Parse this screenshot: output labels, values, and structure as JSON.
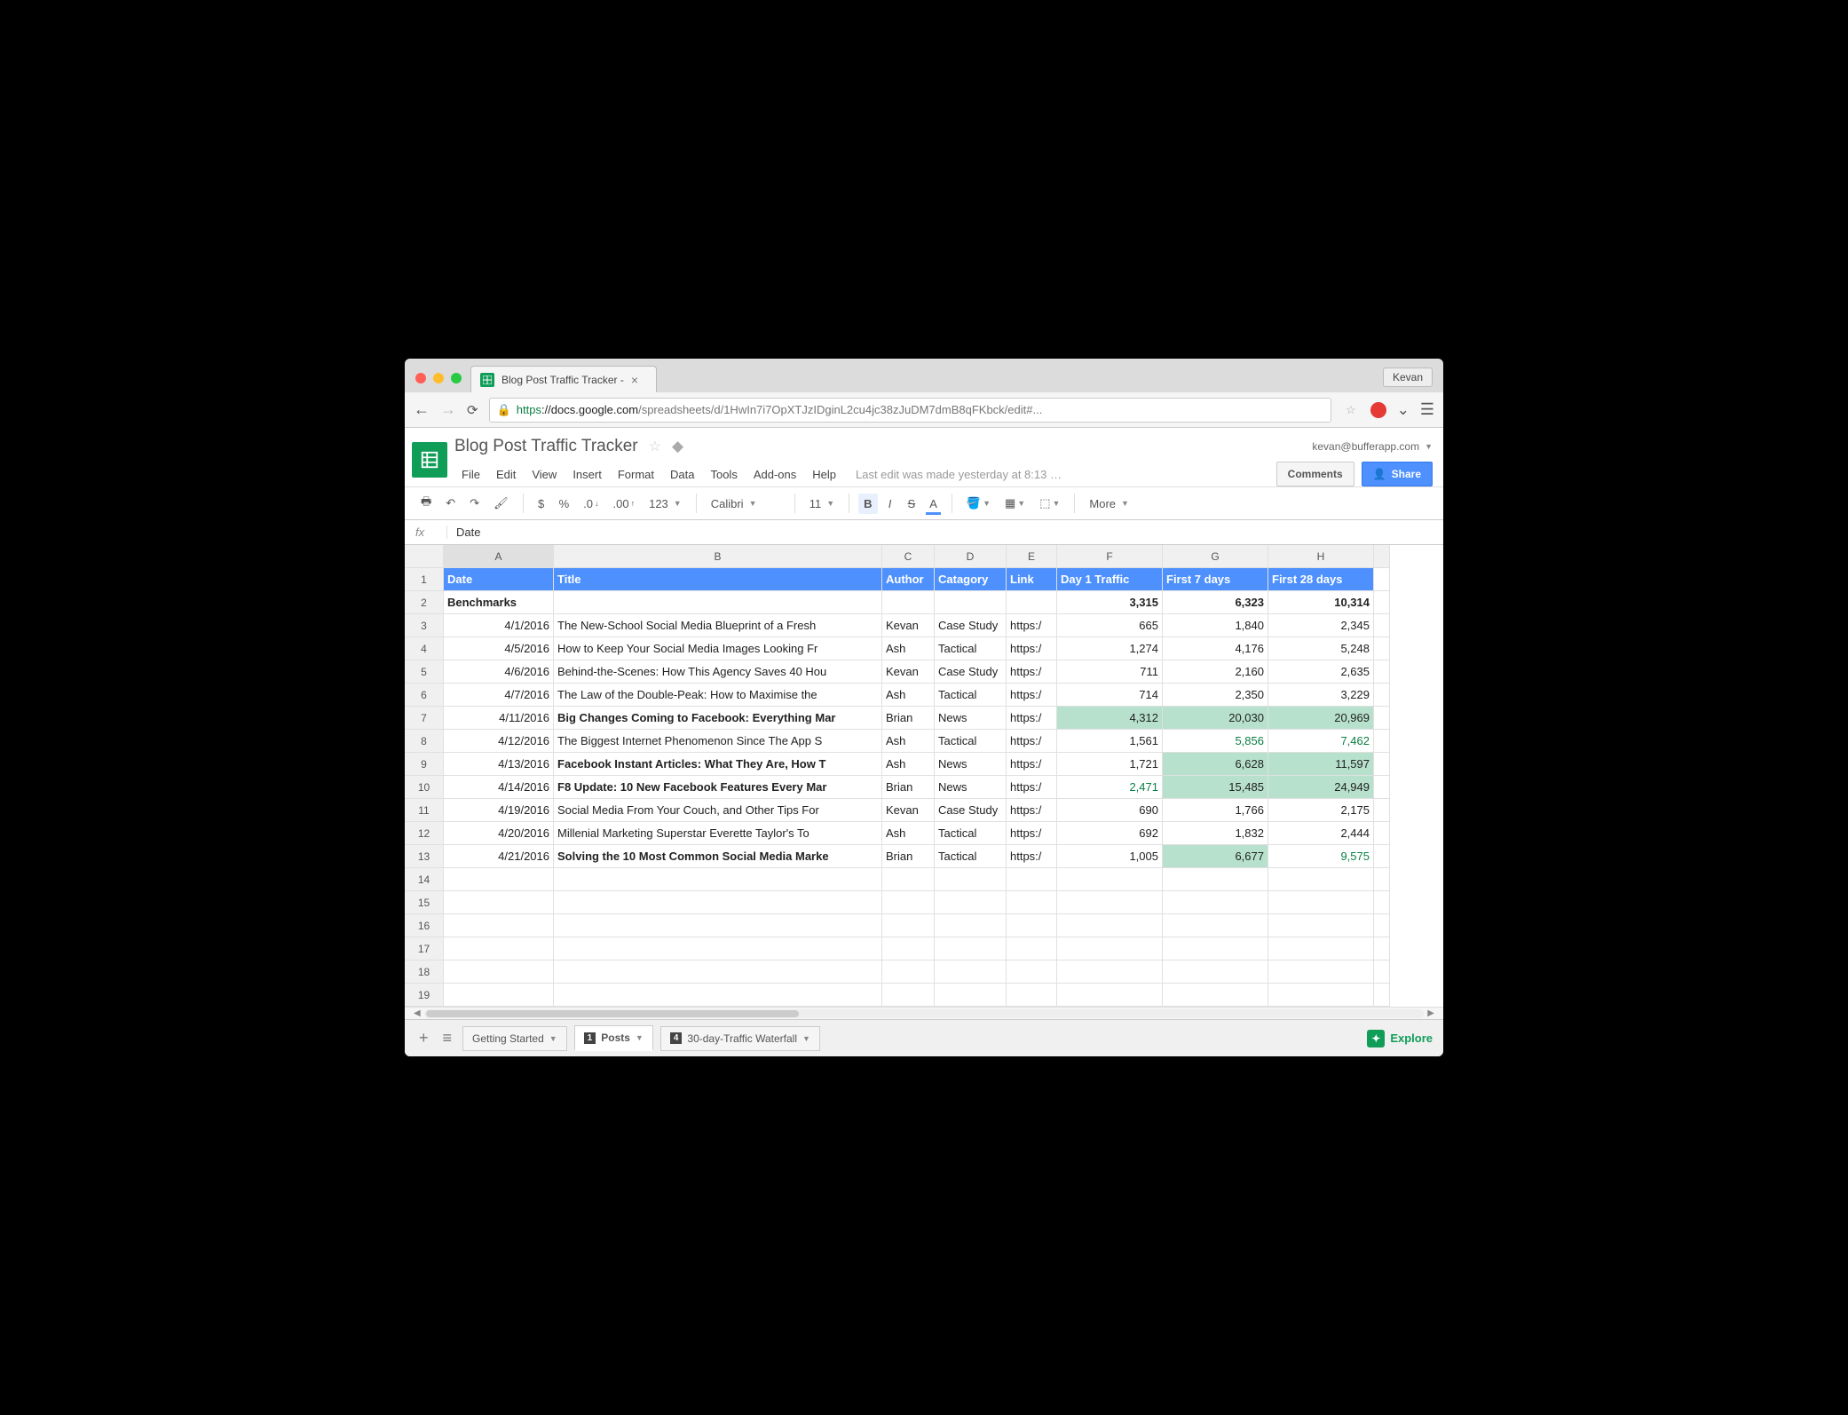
{
  "browser": {
    "tab_title": "Blog Post Traffic Tracker - ",
    "profile": "Kevan",
    "url_proto": "https",
    "url_host": "://docs.google.com",
    "url_path": "/spreadsheets/d/1HwIn7i7OpXTJzIDginL2cu4jc38zJuDM7dmB8qFKbck/edit#..."
  },
  "doc": {
    "title": "Blog Post Traffic Tracker",
    "account": "kevan@bufferapp.com",
    "menus": [
      "File",
      "Edit",
      "View",
      "Insert",
      "Format",
      "Data",
      "Tools",
      "Add-ons",
      "Help"
    ],
    "last_edit": "Last edit was made yesterday at 8:13 …",
    "comments": "Comments",
    "share": "Share"
  },
  "toolbar": {
    "currency": "$",
    "percent": "%",
    "dec_dec": ".0",
    "dec_inc": ".00",
    "num_fmt": "123",
    "font": "Calibri",
    "size": "11",
    "more": "More"
  },
  "formula": {
    "label": "fx",
    "value": "Date"
  },
  "columns": [
    "A",
    "B",
    "C",
    "D",
    "E",
    "F",
    "G",
    "H"
  ],
  "headers": {
    "A": "Date",
    "B": "Title",
    "C": "Author",
    "D": "Catagory",
    "E": "Link",
    "F": "Day 1 Traffic",
    "G": "First 7 days",
    "H": "First 28 days"
  },
  "benchmarks": {
    "label": "Benchmarks",
    "F": "3,315",
    "G": "6,323",
    "H": "10,314"
  },
  "rows": [
    {
      "n": 3,
      "date": "4/1/2016",
      "title": "The New-School Social Media Blueprint of a Fresh",
      "author": "Kevan",
      "cat": "Case Study",
      "link": "https:/",
      "f": "665",
      "g": "1,840",
      "h": "2,345"
    },
    {
      "n": 4,
      "date": "4/5/2016",
      "title": "How to Keep Your Social Media Images Looking Fr",
      "author": "Ash",
      "cat": "Tactical",
      "link": "https:/",
      "f": "1,274",
      "g": "4,176",
      "h": "5,248"
    },
    {
      "n": 5,
      "date": "4/6/2016",
      "title": "Behind-the-Scenes: How This Agency Saves 40 Hou",
      "author": "Kevan",
      "cat": "Case Study",
      "link": "https:/",
      "f": "711",
      "g": "2,160",
      "h": "2,635"
    },
    {
      "n": 6,
      "date": "4/7/2016",
      "title": "The Law of the Double-Peak: How to Maximise the",
      "author": "Ash",
      "cat": "Tactical",
      "link": "https:/",
      "f": "714",
      "g": "2,350",
      "h": "3,229"
    },
    {
      "n": 7,
      "date": "4/11/2016",
      "title": "Big Changes Coming to Facebook: Everything Mar",
      "author": "Brian",
      "cat": "News",
      "link": "https:/",
      "f": "4,312",
      "g": "20,030",
      "h": "20,969",
      "bold": true,
      "f_bg": true,
      "g_bg": true,
      "h_bg": true
    },
    {
      "n": 8,
      "date": "4/12/2016",
      "title": "The Biggest Internet Phenomenon Since The App S",
      "author": "Ash",
      "cat": "Tactical",
      "link": "https:/",
      "f": "1,561",
      "g": "5,856",
      "h": "7,462",
      "g_gt": true,
      "h_gt": true
    },
    {
      "n": 9,
      "date": "4/13/2016",
      "title": "Facebook Instant Articles: What They Are, How T",
      "author": "Ash",
      "cat": "News",
      "link": "https:/",
      "f": "1,721",
      "g": "6,628",
      "h": "11,597",
      "bold": true,
      "g_bg": true,
      "h_bg": true
    },
    {
      "n": 10,
      "date": "4/14/2016",
      "title": "F8 Update: 10 New Facebook Features Every Mar",
      "author": "Brian",
      "cat": "News",
      "link": "https:/",
      "f": "2,471",
      "g": "15,485",
      "h": "24,949",
      "bold": true,
      "f_gt": true,
      "g_bg": true,
      "h_bg": true
    },
    {
      "n": 11,
      "date": "4/19/2016",
      "title": "Social Media From Your Couch, and Other Tips For",
      "author": "Kevan",
      "cat": "Case Study",
      "link": "https:/",
      "f": "690",
      "g": "1,766",
      "h": "2,175"
    },
    {
      "n": 12,
      "date": "4/20/2016",
      "title": "Millenial Marketing Superstar Everette Taylor's To",
      "author": "Ash",
      "cat": "Tactical",
      "link": "https:/",
      "f": "692",
      "g": "1,832",
      "h": "2,444"
    },
    {
      "n": 13,
      "date": "4/21/2016",
      "title": "Solving the 10 Most Common Social Media Marke",
      "author": "Brian",
      "cat": "Tactical",
      "link": "https:/",
      "f": "1,005",
      "g": "6,677",
      "h": "9,575",
      "bold": true,
      "g_bg": true,
      "h_gt": true
    }
  ],
  "empty_rows": [
    14,
    15,
    16,
    17,
    18,
    19
  ],
  "sheets": {
    "getting_started": "Getting Started",
    "posts": "Posts",
    "posts_badge": "1",
    "waterfall": "30-day-Traffic Waterfall",
    "waterfall_badge": "4",
    "explore": "Explore"
  }
}
